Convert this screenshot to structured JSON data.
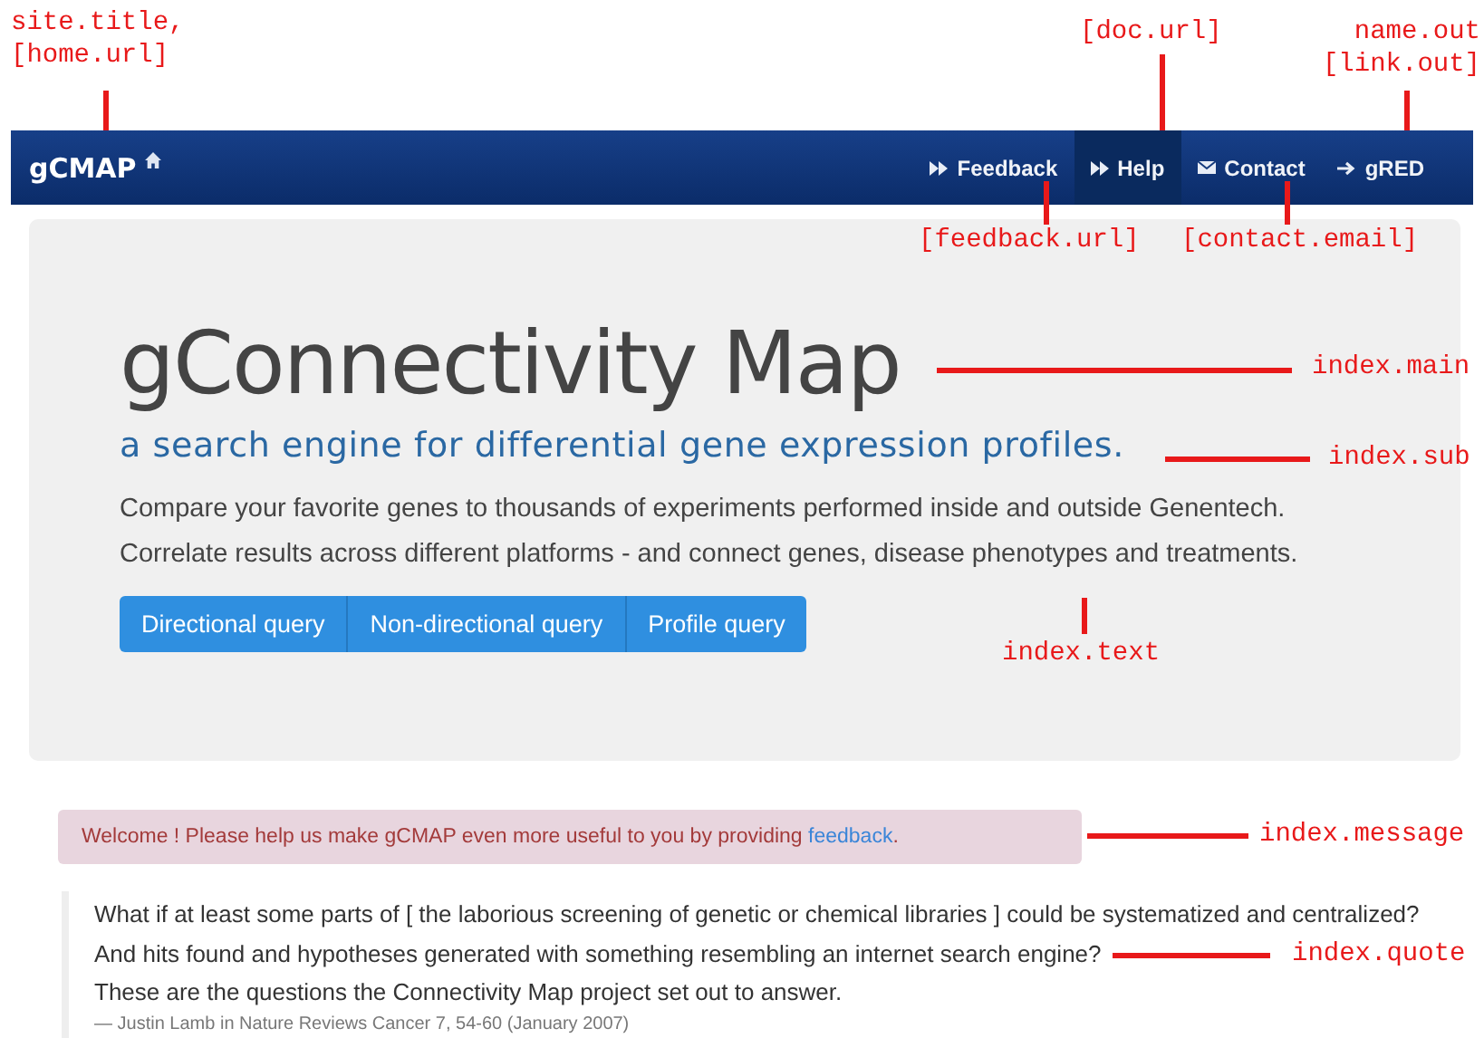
{
  "navbar": {
    "site_title": "gCMAP",
    "items": [
      {
        "kind": "forward",
        "label": "Feedback",
        "selected": false
      },
      {
        "kind": "forward",
        "label": "Help",
        "selected": true
      },
      {
        "kind": "mail",
        "label": "Contact",
        "selected": false
      },
      {
        "kind": "arrow",
        "label": "gRED",
        "selected": false
      }
    ]
  },
  "hero": {
    "title": "gConnectivity Map",
    "subtitle": "a search engine for differential gene expression profiles.",
    "text": [
      "Compare your favorite genes to thousands of experiments performed inside and outside Genentech.",
      "Correlate results across different platforms - and connect genes, disease phenotypes and treatments."
    ],
    "buttons": [
      "Directional query",
      "Non-directional query",
      "Profile query"
    ]
  },
  "message": {
    "text": "Welcome ! Please help us make gCMAP even more useful to you by providing ",
    "link": "feedback",
    "end": "."
  },
  "quote": {
    "lines": [
      "What if at least some parts of [ the laborious screening of genetic or chemical libraries ] could be systematized and centralized?",
      "And hits found and hypotheses generated with something resembling an internet search engine?",
      "These are the questions the Connectivity Map project set out to answer."
    ],
    "citation": "— Justin Lamb in Nature Reviews Cancer 7, 54-60 (January 2007)"
  },
  "annotations": [
    {
      "lines": [
        "site.title,",
        "[home.url]"
      ]
    },
    {
      "lines": [
        "[doc.url]"
      ]
    },
    {
      "lines": [
        "name.out",
        "[link.out]"
      ]
    },
    {
      "lines": [
        "[feedback.url]"
      ]
    },
    {
      "lines": [
        "[contact.email]"
      ]
    },
    {
      "lines": [
        "index.main"
      ]
    },
    {
      "lines": [
        "index.sub"
      ]
    },
    {
      "lines": [
        "index.text"
      ]
    },
    {
      "lines": [
        "index.message"
      ]
    },
    {
      "lines": [
        "index.quote"
      ]
    }
  ]
}
